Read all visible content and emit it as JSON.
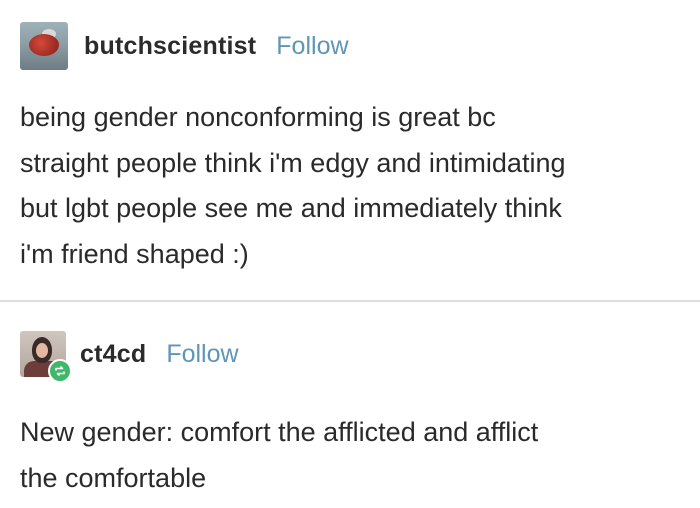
{
  "posts": [
    {
      "username": "butchscientist",
      "follow_label": "Follow",
      "lines": [
        "being gender nonconforming is great bc",
        "straight people think i'm edgy and intimidating",
        "but lgbt people see me and immediately think",
        "i'm friend shaped :)"
      ]
    },
    {
      "username": "ct4cd",
      "follow_label": "Follow",
      "lines": [
        "New gender: comfort the afflicted and afflict",
        "the comfortable"
      ]
    }
  ],
  "colors": {
    "follow": "#5f95b5",
    "reblog_badge": "#3fb86b",
    "divider": "#dedede"
  },
  "icons": {
    "reblog": "reblog-icon"
  }
}
